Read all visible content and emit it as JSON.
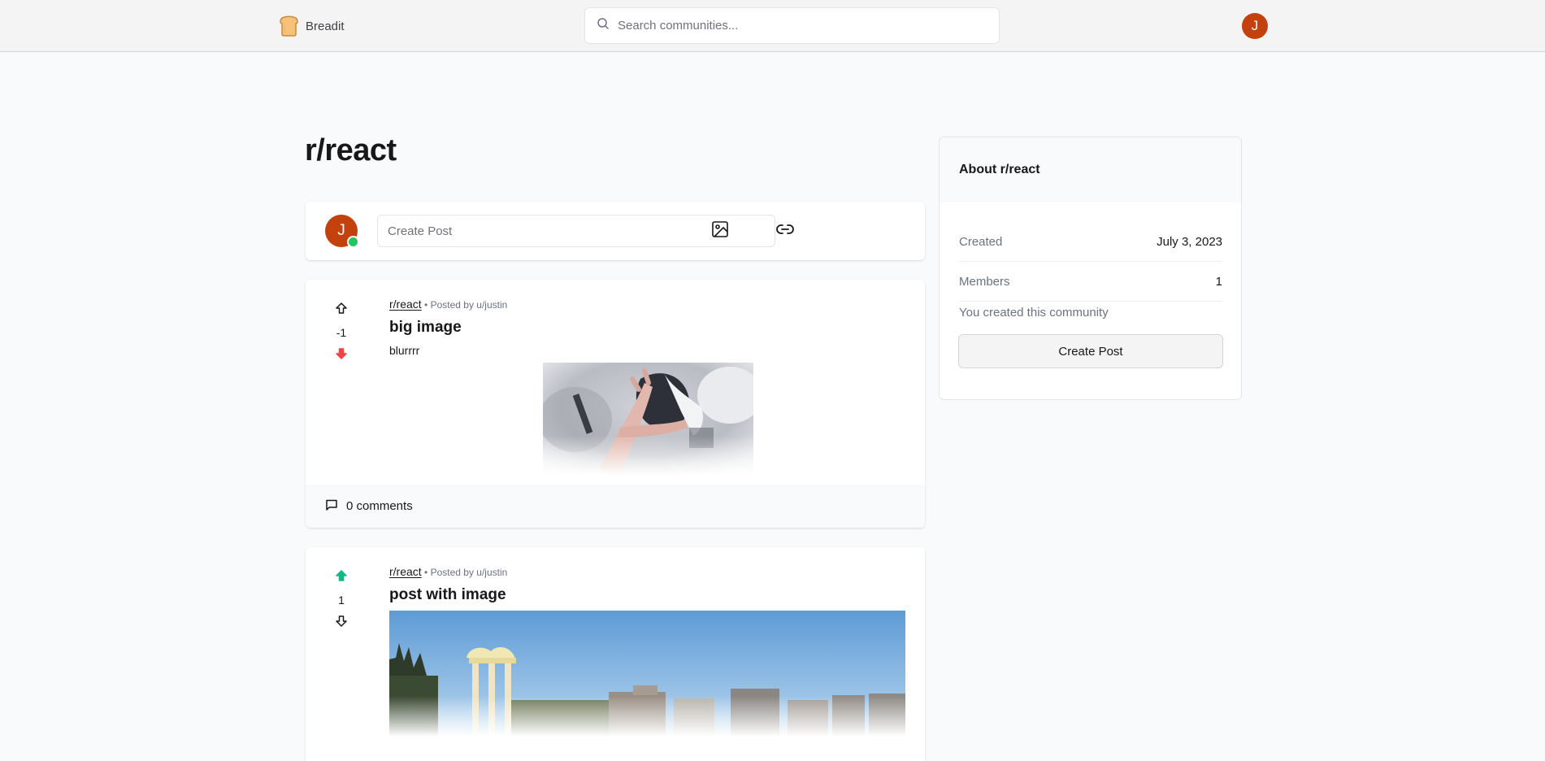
{
  "navbar": {
    "brand_name": "Breadit",
    "search_placeholder": "Search communities...",
    "avatar_initial": "J"
  },
  "community": {
    "title": "r/react"
  },
  "create_post": {
    "avatar_initial": "J",
    "placeholder": "Create Post",
    "image_icon": "image-icon",
    "link_icon": "link-icon"
  },
  "posts": [
    {
      "subreddit": "r/react",
      "posted_by": "Posted by u/justin",
      "title": "big image",
      "body": "blurrrr",
      "score": "-1",
      "vote": "down",
      "comments": "0 comments"
    },
    {
      "subreddit": "r/react",
      "posted_by": "Posted by u/justin",
      "title": "post with image",
      "body": "",
      "score": "1",
      "vote": "up"
    }
  ],
  "about": {
    "heading": "About r/react",
    "created_label": "Created",
    "created_value": "July 3, 2023",
    "members_label": "Members",
    "members_value": "1",
    "note": "You created this community",
    "button": "Create Post"
  },
  "colors": {
    "accent_avatar": "#c2410c",
    "online": "#22c55e",
    "upvote_active": "#10b981",
    "downvote_active": "#ef4444"
  }
}
